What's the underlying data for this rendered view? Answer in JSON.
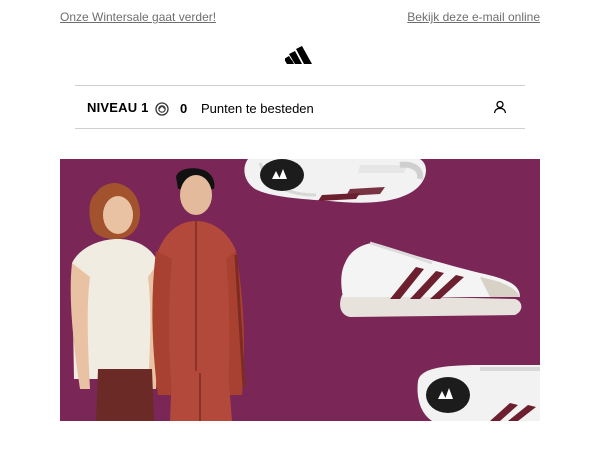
{
  "preheader": {
    "left_link": "Onze Wintersale gaat verder!",
    "right_link": "Bekijk deze e-mail online"
  },
  "brand": {
    "logo_icon": "adidas-performance-logo-icon"
  },
  "loyalty": {
    "level_prefix": "NIVEAU",
    "level_number": "1",
    "points_icon": "points-coin-icon",
    "points_value": "0",
    "points_label": "Punten te besteden",
    "account_icon": "account-icon"
  },
  "hero": {
    "background_color": "#7a2757",
    "shoe_logo_text": "adidas"
  }
}
